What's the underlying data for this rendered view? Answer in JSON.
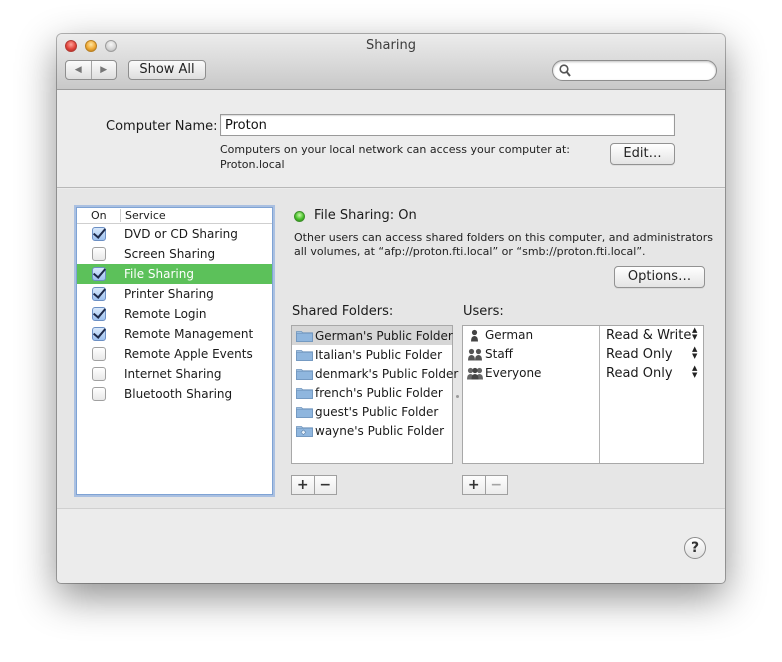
{
  "window": {
    "title": "Sharing",
    "traffic_lights": [
      "close",
      "minimize",
      "zoom"
    ]
  },
  "toolbar": {
    "back_icon": "◀",
    "forward_icon": "▶",
    "show_all_label": "Show All",
    "search_placeholder": "",
    "search_icon": "search-icon"
  },
  "computer_name": {
    "label": "Computer Name:",
    "value": "Proton",
    "info_line1": "Computers on your local network can access your computer at:",
    "info_line2": "Proton.local",
    "edit_label": "Edit…"
  },
  "services": {
    "header_on": "On",
    "header_service": "Service",
    "items": [
      {
        "label": "DVD or CD Sharing",
        "on": true,
        "selected": false
      },
      {
        "label": "Screen Sharing",
        "on": false,
        "selected": false
      },
      {
        "label": "File Sharing",
        "on": true,
        "selected": true
      },
      {
        "label": "Printer Sharing",
        "on": true,
        "selected": false
      },
      {
        "label": "Remote Login",
        "on": true,
        "selected": false
      },
      {
        "label": "Remote Management",
        "on": true,
        "selected": false
      },
      {
        "label": "Remote Apple Events",
        "on": false,
        "selected": false
      },
      {
        "label": "Internet Sharing",
        "on": false,
        "selected": false
      },
      {
        "label": "Bluetooth Sharing",
        "on": false,
        "selected": false
      }
    ]
  },
  "status": {
    "text": "File Sharing: On",
    "color": "#48c22b",
    "description": "Other users can access shared folders on this computer, and administrators all volumes, at “afp://proton.fti.local” or “smb://proton.fti.local”.",
    "options_label": "Options…"
  },
  "shared_folders": {
    "label": "Shared Folders:",
    "items": [
      {
        "name": "German's Public Folder",
        "selected": true,
        "icon": "folder-icon"
      },
      {
        "name": "Italian's Public Folder",
        "selected": false,
        "icon": "folder-icon"
      },
      {
        "name": "denmark's Public Folder",
        "selected": false,
        "icon": "folder-icon"
      },
      {
        "name": "french's Public Folder",
        "selected": false,
        "icon": "folder-icon"
      },
      {
        "name": "guest's Public Folder",
        "selected": false,
        "icon": "folder-icon"
      },
      {
        "name": "wayne's Public Folder",
        "selected": false,
        "icon": "public-folder-icon"
      }
    ],
    "add_label": "+",
    "remove_label": "−"
  },
  "users": {
    "label": "Users:",
    "items": [
      {
        "name": "German",
        "permission": "Read & Write",
        "icon": "user-icon"
      },
      {
        "name": "Staff",
        "permission": "Read Only",
        "icon": "group-icon"
      },
      {
        "name": "Everyone",
        "permission": "Read Only",
        "icon": "everyone-icon"
      }
    ],
    "add_label": "+",
    "remove_label": "−",
    "stepper_glyph": "▲\n▼"
  },
  "help_label": "?"
}
